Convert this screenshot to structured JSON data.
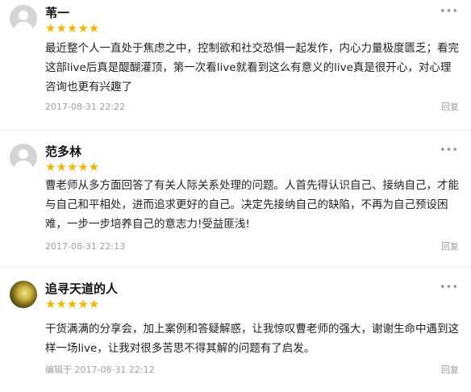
{
  "reviews": [
    {
      "name": "苇一",
      "stars": "★★★★★",
      "text": "最近整个人一直处于焦虑之中，控制欲和社交恐惧一起发作，内心力量极度匮乏；看完这部live后真是醍醐灌顶，第一次看live就看到这么有意义的live真是很开心，对心理咨询也更有兴趣了",
      "meta": "2017-08-31 22:22",
      "reply": "回复",
      "more": "•••"
    },
    {
      "name": "范多林",
      "stars": "★★★★★",
      "text": "曹老师从多方面回答了有关人际关系处理的问题。人首先得认识自己、接纳自己，才能与自己和平相处，进而追求更好的自己。决定先接纳自己的缺陷，不再为自己预设困难，一步一步培养自己的意志力!受益匪浅!",
      "meta": "2017-08-31 22:13",
      "reply": "回复",
      "more": "•••"
    },
    {
      "name": "追寻天道的人",
      "stars": "★★★★★",
      "text": "干货满满的分享会，加上案例和答疑解惑，让我惊叹曹老师的强大，谢谢生命中遇到这样一场live，让我对很多苦思不得其解的问题有了启发。",
      "meta": "编辑于 2017-08-31 22:12",
      "reply": "回复",
      "more": "•••"
    }
  ]
}
